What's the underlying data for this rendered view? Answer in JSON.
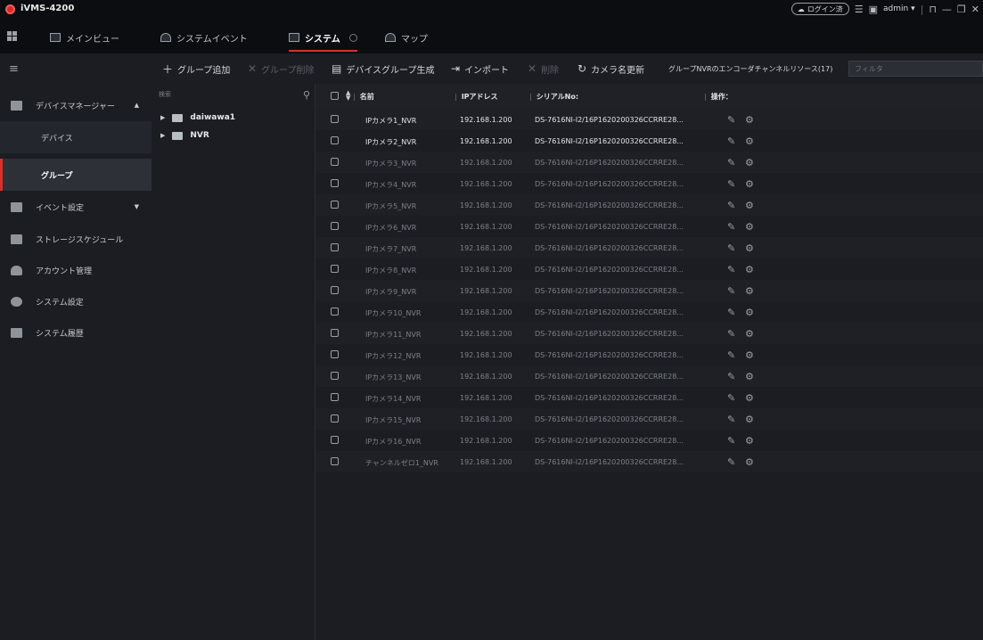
{
  "app": {
    "title": "iVMS-4200",
    "login_status": "ログイン済",
    "user": "admin"
  },
  "tabs": [
    {
      "label": "メインビュー",
      "icon": "monitor-icon"
    },
    {
      "label": "システムイベント",
      "icon": "alarm-icon"
    },
    {
      "label": "システム",
      "icon": "system-icon",
      "active": true
    },
    {
      "label": "マップ",
      "icon": "map-icon"
    }
  ],
  "sidebar": {
    "items": [
      {
        "label": "デバイスマネージャー",
        "icon": "device-manager-icon",
        "expanded": true
      },
      {
        "label": "デバイス"
      },
      {
        "label": "グループ",
        "active": true
      },
      {
        "label": "イベント設定",
        "icon": "event-icon"
      },
      {
        "label": "ストレージスケジュール",
        "icon": "storage-icon"
      },
      {
        "label": "アカウント管理",
        "icon": "account-icon"
      },
      {
        "label": "システム設定",
        "icon": "settings-icon"
      },
      {
        "label": "システム履歴",
        "icon": "log-icon"
      }
    ]
  },
  "toolbar": {
    "add_group": "グループ追加",
    "delete_group": "グループ削除",
    "create_device_group": "デバイスグループ生成",
    "import": "インポート",
    "delete": "削除",
    "update_camera_name": "カメラ名更新",
    "resources": "グループNVRのエンコーダチャンネルリソース(17)",
    "filter_placeholder": "フィルタ"
  },
  "tree": {
    "search_placeholder": "検索",
    "nodes": [
      {
        "label": "daiwawa1"
      },
      {
        "label": "NVR"
      }
    ]
  },
  "table": {
    "columns": {
      "name": "名前",
      "ip": "IPアドレス",
      "serial": "シリアルNo:",
      "ops": "操作："
    },
    "rows": [
      {
        "name": "IPカメラ1_NVR",
        "ip": "192.168.1.200",
        "serial": "DS-7616NI-I2/16P1620200326CCRRE28...",
        "online": true
      },
      {
        "name": "IPカメラ2_NVR",
        "ip": "192.168.1.200",
        "serial": "DS-7616NI-I2/16P1620200326CCRRE28...",
        "online": true
      },
      {
        "name": "IPカメラ3_NVR",
        "ip": "192.168.1.200",
        "serial": "DS-7616NI-I2/16P1620200326CCRRE28...",
        "online": false
      },
      {
        "name": "IPカメラ4_NVR",
        "ip": "192.168.1.200",
        "serial": "DS-7616NI-I2/16P1620200326CCRRE28...",
        "online": false
      },
      {
        "name": "IPカメラ5_NVR",
        "ip": "192.168.1.200",
        "serial": "DS-7616NI-I2/16P1620200326CCRRE28...",
        "online": false
      },
      {
        "name": "IPカメラ6_NVR",
        "ip": "192.168.1.200",
        "serial": "DS-7616NI-I2/16P1620200326CCRRE28...",
        "online": false
      },
      {
        "name": "IPカメラ7_NVR",
        "ip": "192.168.1.200",
        "serial": "DS-7616NI-I2/16P1620200326CCRRE28...",
        "online": false
      },
      {
        "name": "IPカメラ8_NVR",
        "ip": "192.168.1.200",
        "serial": "DS-7616NI-I2/16P1620200326CCRRE28...",
        "online": false
      },
      {
        "name": "IPカメラ9_NVR",
        "ip": "192.168.1.200",
        "serial": "DS-7616NI-I2/16P1620200326CCRRE28...",
        "online": false
      },
      {
        "name": "IPカメラ10_NVR",
        "ip": "192.168.1.200",
        "serial": "DS-7616NI-I2/16P1620200326CCRRE28...",
        "online": false
      },
      {
        "name": "IPカメラ11_NVR",
        "ip": "192.168.1.200",
        "serial": "DS-7616NI-I2/16P1620200326CCRRE28...",
        "online": false
      },
      {
        "name": "IPカメラ12_NVR",
        "ip": "192.168.1.200",
        "serial": "DS-7616NI-I2/16P1620200326CCRRE28...",
        "online": false
      },
      {
        "name": "IPカメラ13_NVR",
        "ip": "192.168.1.200",
        "serial": "DS-7616NI-I2/16P1620200326CCRRE28...",
        "online": false
      },
      {
        "name": "IPカメラ14_NVR",
        "ip": "192.168.1.200",
        "serial": "DS-7616NI-I2/16P1620200326CCRRE28...",
        "online": false
      },
      {
        "name": "IPカメラ15_NVR",
        "ip": "192.168.1.200",
        "serial": "DS-7616NI-I2/16P1620200326CCRRE28...",
        "online": false
      },
      {
        "name": "IPカメラ16_NVR",
        "ip": "192.168.1.200",
        "serial": "DS-7616NI-I2/16P1620200326CCRRE28...",
        "online": false
      },
      {
        "name": "チャンネルゼロ1_NVR",
        "ip": "192.168.1.200",
        "serial": "DS-7616NI-I2/16P1620200326CCRRE28...",
        "online": false
      }
    ]
  },
  "colors": {
    "accent": "#d9302b",
    "background": "#1b1d22",
    "offline_text": "#7c8088"
  }
}
